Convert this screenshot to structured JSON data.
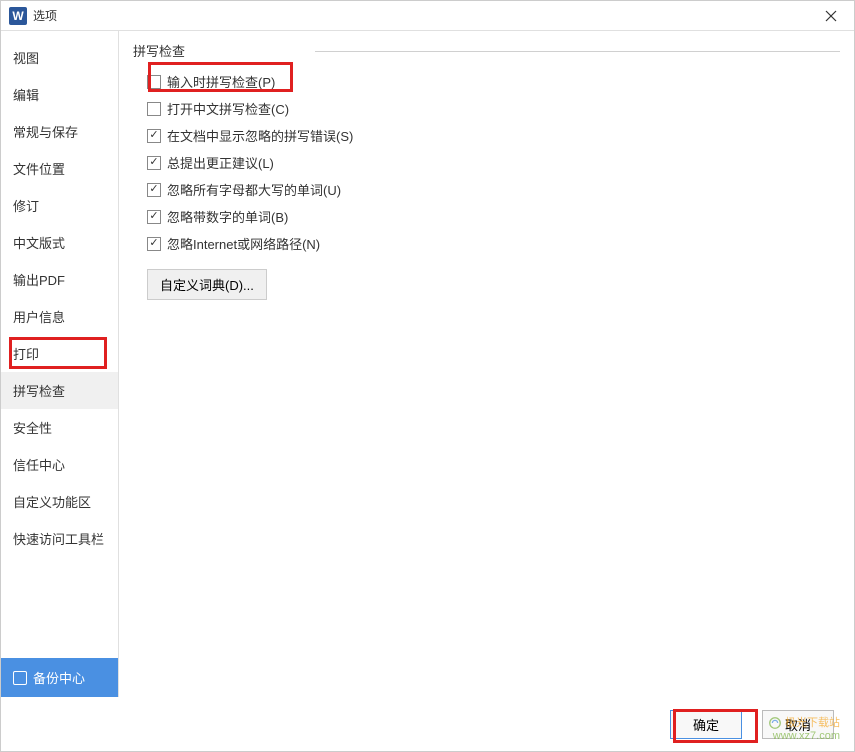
{
  "titlebar": {
    "app_icon_letter": "W",
    "title": "选项"
  },
  "sidebar": {
    "items": [
      "视图",
      "编辑",
      "常规与保存",
      "文件位置",
      "修订",
      "中文版式",
      "输出PDF",
      "用户信息",
      "打印",
      "拼写检查",
      "安全性",
      "信任中心",
      "自定义功能区",
      "快速访问工具栏"
    ],
    "active_index": 9,
    "backup_label": "备份中心"
  },
  "content": {
    "section_title": "拼写检查",
    "checkboxes": [
      {
        "label": "输入时拼写检查(P)",
        "checked": false
      },
      {
        "label": "打开中文拼写检查(C)",
        "checked": false
      },
      {
        "label": "在文档中显示忽略的拼写错误(S)",
        "checked": true
      },
      {
        "label": "总提出更正建议(L)",
        "checked": true
      },
      {
        "label": "忽略所有字母都大写的单词(U)",
        "checked": true
      },
      {
        "label": "忽略带数字的单词(B)",
        "checked": true
      },
      {
        "label": "忽略Internet或网络路径(N)",
        "checked": true
      }
    ],
    "custom_dict_btn": "自定义词典(D)..."
  },
  "footer": {
    "ok": "确定",
    "cancel": "取消"
  },
  "watermark": {
    "line1": "极光下载站",
    "line2": "www.xz7.com"
  }
}
